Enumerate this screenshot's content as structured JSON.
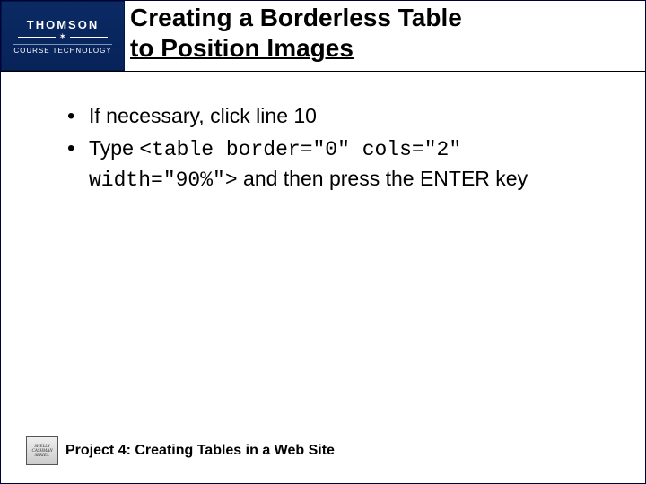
{
  "logo": {
    "brand_top": "THOMSON",
    "brand_bottom": "COURSE TECHNOLOGY"
  },
  "title": {
    "line1": "Creating a Borderless Table",
    "line2": "to Position Images"
  },
  "bullets": [
    {
      "plain": "If necessary, click line 10"
    },
    {
      "lead": "Type ",
      "code": "<table border=\"0\" cols=\"2\" width=\"90%\">",
      "tail": " and then press the ENTER key"
    }
  ],
  "footer": {
    "series": {
      "l1": "SHELLY",
      "l2": "CASHMAN",
      "l3": "SERIES."
    },
    "text": "Project 4: Creating Tables in a Web Site"
  }
}
